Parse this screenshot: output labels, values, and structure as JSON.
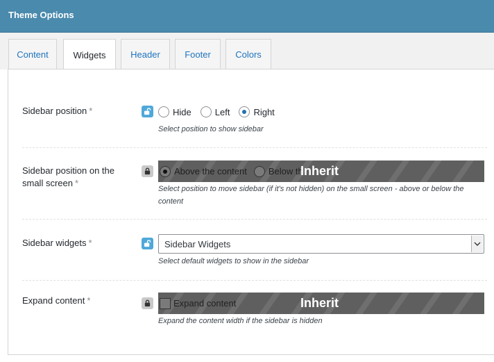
{
  "window": {
    "title": "Theme Options"
  },
  "tabs": [
    {
      "label": "Content"
    },
    {
      "label": "Widgets"
    },
    {
      "label": "Header"
    },
    {
      "label": "Footer"
    },
    {
      "label": "Colors"
    }
  ],
  "active_tab": "Widgets",
  "required_mark": "*",
  "fields": {
    "sidebar_position": {
      "label": "Sidebar position",
      "options": [
        "Hide",
        "Left",
        "Right"
      ],
      "selected": "Right",
      "description": "Select position to show sidebar",
      "lock": "unlocked"
    },
    "sidebar_position_ss": {
      "label_line1": "Sidebar position on the",
      "label_line2": "small screen",
      "options": [
        "Above the content",
        "Below th"
      ],
      "selected": "Above the content",
      "overlay": "Inherit",
      "description_line1": "Select position to move sidebar (if it's not hidden) on the small screen - above or below the",
      "description_line2": "content",
      "lock": "locked"
    },
    "sidebar_widgets": {
      "label": "Sidebar widgets",
      "value": "Sidebar Widgets",
      "description": "Select default widgets to show in the sidebar",
      "lock": "unlocked"
    },
    "expand_content": {
      "label": "Expand content",
      "checkbox_label": "Expand content",
      "checked": false,
      "overlay": "Inherit",
      "description": "Expand the content width if the sidebar is hidden",
      "lock": "locked"
    }
  },
  "colors": {
    "titlebar": "#4a8aad",
    "accent": "#1e73be",
    "lock_open": "#4fa8d9",
    "inherit_overlay": "#5f5f5f"
  }
}
